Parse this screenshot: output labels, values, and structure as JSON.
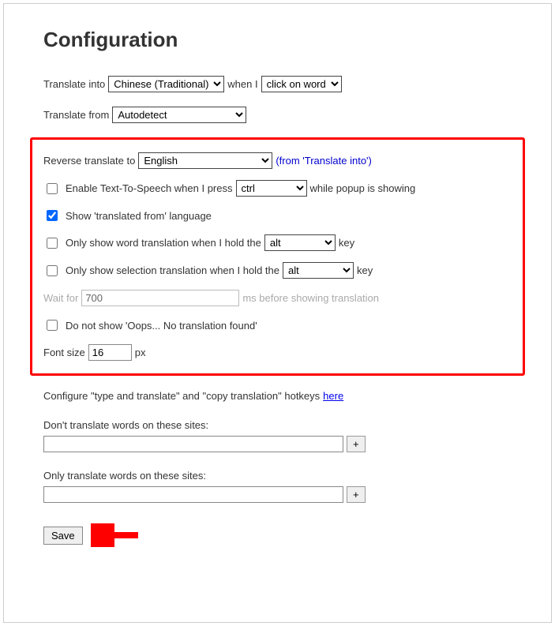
{
  "heading": "Configuration",
  "translateInto": {
    "label_before": "Translate into",
    "selected": "Chinese (Traditional)",
    "label_mid": "when I",
    "trigger": "click on word"
  },
  "translateFrom": {
    "label": "Translate from",
    "selected": "Autodetect"
  },
  "reverse": {
    "label": "Reverse translate to",
    "selected": "English",
    "note": "(from 'Translate into')"
  },
  "tts": {
    "label_before": "Enable Text-To-Speech when I press",
    "selected": "ctrl",
    "label_after": "while popup is showing"
  },
  "showFrom": {
    "label": "Show 'translated from' language"
  },
  "holdWord": {
    "label_before": "Only show word translation when I hold the",
    "selected": "alt",
    "label_after": "key"
  },
  "holdSelection": {
    "label_before": "Only show selection translation when I hold the",
    "selected": "alt",
    "label_after": "key"
  },
  "wait": {
    "label_before": "Wait for",
    "value": "700",
    "label_after": "ms before showing translation"
  },
  "oops": {
    "label": "Do not show 'Oops... No translation found'"
  },
  "fontSize": {
    "label_before": "Font size",
    "value": "16",
    "label_after": "px"
  },
  "hotkeys": {
    "text": "Configure \"type and translate\" and \"copy translation\" hotkeys ",
    "link": "here"
  },
  "sitesBlock": {
    "label": "Don't translate words on these sites:",
    "add": "+"
  },
  "sitesOnly": {
    "label": "Only translate words on these sites:",
    "add": "+"
  },
  "save": "Save"
}
